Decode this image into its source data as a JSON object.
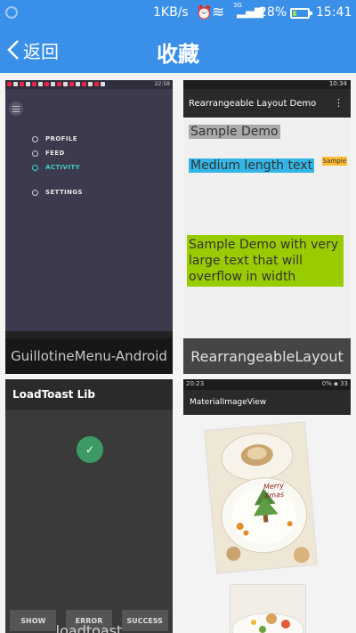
{
  "status_bar": {
    "network_speed": "1KB/s",
    "signal_type": "3G",
    "battery_percent": "28%",
    "battery_level": 0.28,
    "time": "15:41",
    "icons": [
      "notification-icon",
      "alarm-icon",
      "wifi-icon",
      "signal-icon",
      "battery-icon"
    ]
  },
  "title_bar": {
    "back_label": "返回",
    "title": "收藏"
  },
  "favorites": [
    {
      "caption": "GuillotineMenu-Android",
      "menu_items": [
        "PROFILE",
        "FEED",
        "ACTIVITY",
        "SETTINGS"
      ],
      "mini_time": "22:58"
    },
    {
      "caption": "RearrangeableLayout",
      "mini_time": "10:34",
      "app_title": "Rearrangeable Layout Demo",
      "sample_1": "Sample Demo",
      "sample_2": "Medium length text",
      "sample_3": "Sample",
      "sample_4": "Sample Demo with very large text that will overflow in width"
    },
    {
      "caption": "loadtoast",
      "app_title": "LoadToast Lib",
      "buttons": [
        "SHOW",
        "ERROR",
        "SUCCESS"
      ]
    },
    {
      "mini_time": "20:23",
      "mini_battery": "0%",
      "mini_right": "33",
      "app_title": "MaterialImageView",
      "plate_text": "Merry Xmas"
    }
  ],
  "colors": {
    "header_blue": "#3a8fe8",
    "accent_teal": "#3ed0d0",
    "toast_green": "#3d9a66"
  }
}
